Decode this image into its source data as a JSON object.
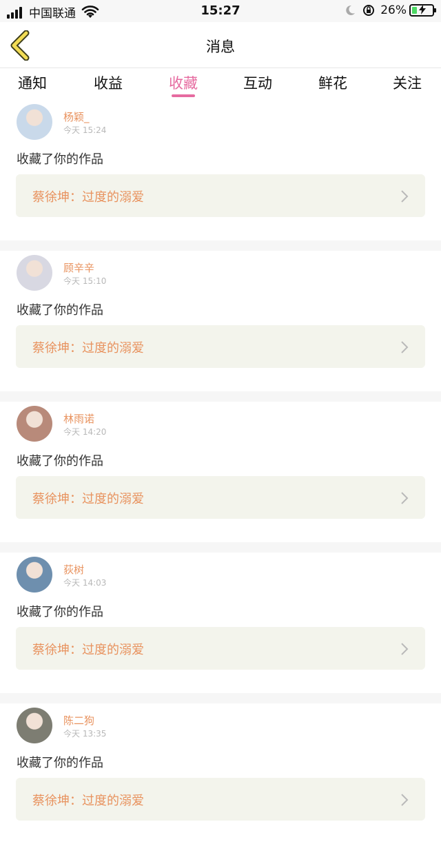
{
  "status_bar": {
    "carrier": "中国联通",
    "time": "15:27",
    "battery": "26%",
    "battery_level": 0.26
  },
  "header": {
    "title": "消息"
  },
  "tabs": [
    {
      "label": "通知"
    },
    {
      "label": "收益"
    },
    {
      "label": "收藏",
      "active": true
    },
    {
      "label": "互动"
    },
    {
      "label": "鲜花"
    },
    {
      "label": "关注"
    }
  ],
  "notifications": [
    {
      "user": "杨颖_",
      "time": "今天 15:24",
      "action": "收藏了你的作品",
      "work": "蔡徐坤：过度的溺爱",
      "avatar_color": "#c9d9ea"
    },
    {
      "user": "顾辛辛",
      "time": "今天 15:10",
      "action": "收藏了你的作品",
      "work": "蔡徐坤：过度的溺爱",
      "avatar_color": "#d8d8e2"
    },
    {
      "user": "林雨诺",
      "time": "今天 14:20",
      "action": "收藏了你的作品",
      "work": "蔡徐坤：过度的溺爱",
      "avatar_color": "#b88a7a"
    },
    {
      "user": "荻树",
      "time": "今天 14:03",
      "action": "收藏了你的作品",
      "work": "蔡徐坤：过度的溺爱",
      "avatar_color": "#6e8fae"
    },
    {
      "user": "陈二狗",
      "time": "今天 13:35",
      "action": "收藏了你的作品",
      "work": "蔡徐坤：过度的溺爱",
      "avatar_color": "#7d7d72"
    }
  ],
  "colors": {
    "accent": "#e66ba0",
    "name": "#e8925e",
    "card_bg": "#f3f4ec"
  }
}
